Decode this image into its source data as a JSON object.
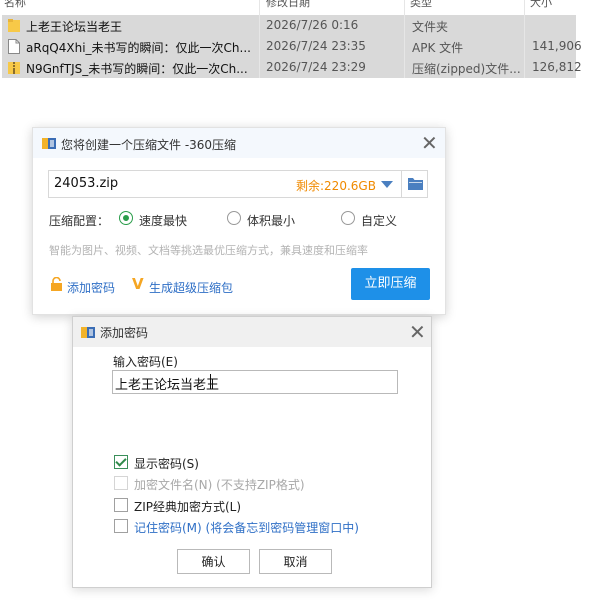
{
  "file_list": {
    "header": {
      "col1": "名称",
      "col2": "修改日期",
      "col3": "类型",
      "col4": "大小"
    },
    "rows": [
      {
        "name": "上老王论坛当老王",
        "date": "2026/7/26 0:16",
        "type": "文件夹",
        "size": "",
        "icon": "folder-icon"
      },
      {
        "name": "aRqQ4Xhi_未书写的瞬间：仅此一次Ch...",
        "date": "2026/7/24 23:35",
        "type": "APK 文件",
        "size": "141,906",
        "icon": "file-icon"
      },
      {
        "name": "N9GnfTJS_未书写的瞬间：仅此一次Ch...",
        "date": "2026/7/24 23:29",
        "type": "压缩(zipped)文件...",
        "size": "126,812",
        "icon": "zip-folder-icon"
      }
    ]
  },
  "compress_dialog": {
    "title": "您将创建一个压缩文件 -360压缩",
    "filename": "24053.zip",
    "free_space": "剩余:220.6GB",
    "options_label": "压缩配置：",
    "options": [
      "速度最快",
      "体积最小",
      "自定义"
    ],
    "selected_option": "速度最快",
    "hint": "智能为图片、视频、文档等挑选最优压缩方式，兼具速度和压缩率",
    "add_password": "添加密码",
    "super_package": "生成超级压缩包",
    "compress_button": "立即压缩",
    "accent": "#1e90e8"
  },
  "password_dialog": {
    "title": "添加密码",
    "input_label": "输入密码(E)",
    "password_value": "上老王论坛当老王",
    "options": [
      {
        "label": "显示密码(S)",
        "checked": true,
        "disabled": false
      },
      {
        "label": "加密文件名(N) (不支持ZIP格式)",
        "checked": false,
        "disabled": true
      },
      {
        "label": "ZIP经典加密方式(L)",
        "checked": false,
        "disabled": false
      },
      {
        "label": "记住密码(M) (将会备忘到密码管理窗口中)",
        "checked": false,
        "disabled": false
      }
    ],
    "ok_button": "确认",
    "cancel_button": "取消"
  }
}
